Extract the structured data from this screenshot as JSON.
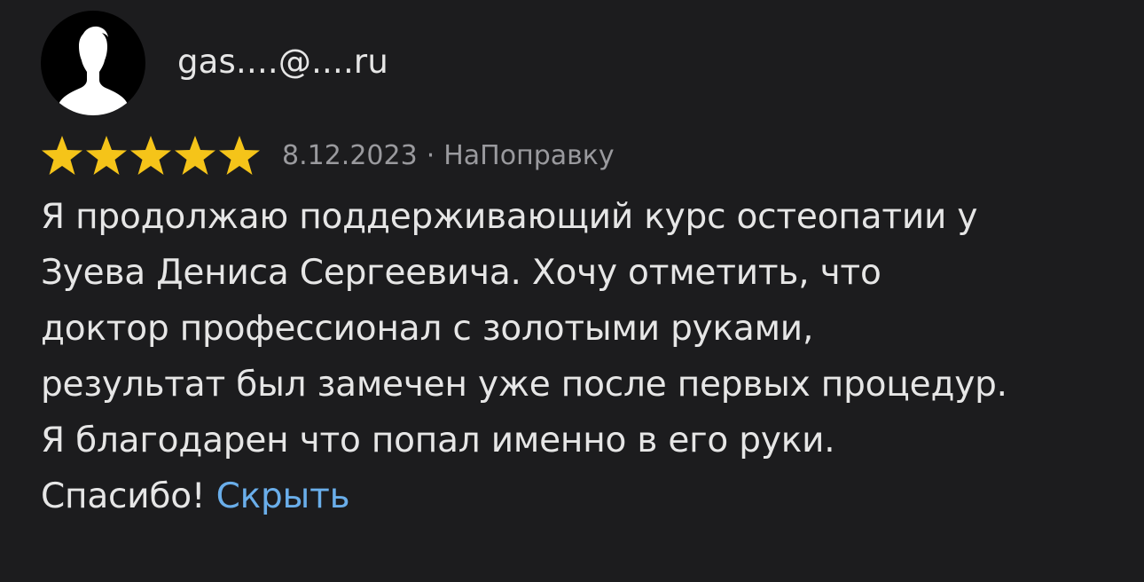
{
  "author": {
    "name": "gas....@....ru",
    "avatar_icon": "user-silhouette-icon"
  },
  "rating": {
    "stars": 5,
    "max": 5,
    "color": "#f5c419"
  },
  "meta": {
    "date": "8.12.2023",
    "separator": "·",
    "source": "НаПоправку"
  },
  "review": {
    "lines": [
      "Я продолжаю поддерживающий курс остеопатии у",
      "Зуева Дениса Сергеевича. Хочу отметить, что",
      "доктор профессионал с золотыми руками,",
      "результат был замечен уже после первых процедур.",
      "Я благодарен что попал именно в его руки.",
      "Спасибо!"
    ],
    "hide_label": "Скрыть"
  },
  "colors": {
    "background": "#1c1c1e",
    "text": "#e6e6e6",
    "muted": "#9a9a9e",
    "link": "#6aaeea"
  }
}
